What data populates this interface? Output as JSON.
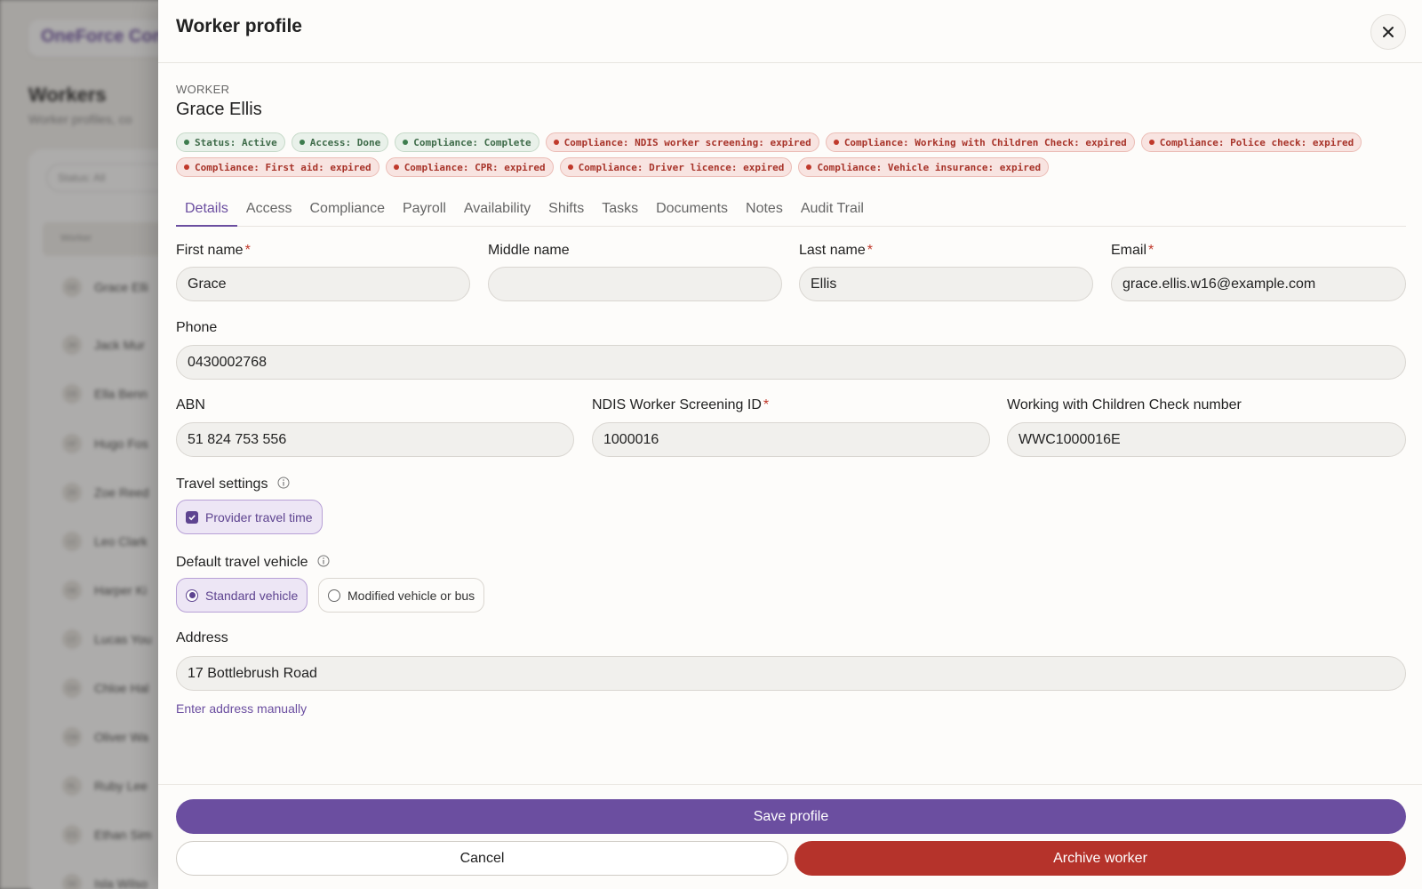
{
  "background": {
    "logo_text": "OneForce Con",
    "page_title": "Workers",
    "page_subtitle": "Worker profiles, co",
    "filter_label": "Status: All",
    "table_header": "Worker",
    "rows": [
      {
        "initials": "GE",
        "name": "Grace Elli"
      },
      {
        "initials": "JM",
        "name": "Jack Mur"
      },
      {
        "initials": "EB",
        "name": "Ella Benn"
      },
      {
        "initials": "HF",
        "name": "Hugo Fos"
      },
      {
        "initials": "ZR",
        "name": "Zoe Reed"
      },
      {
        "initials": "LC",
        "name": "Leo Clark"
      },
      {
        "initials": "HK",
        "name": "Harper Ki"
      },
      {
        "initials": "LY",
        "name": "Lucas You"
      },
      {
        "initials": "CH",
        "name": "Chloe Hal"
      },
      {
        "initials": "OW",
        "name": "Oliver Wa"
      },
      {
        "initials": "RL",
        "name": "Ruby Lee"
      },
      {
        "initials": "ES",
        "name": "Ethan Sim"
      },
      {
        "initials": "IW",
        "name": "Isla Wilso"
      }
    ]
  },
  "panel": {
    "title": "Worker profile",
    "eyebrow": "WORKER",
    "worker_name": "Grace Ellis",
    "badges": [
      {
        "text": "Status: Active",
        "tone": "ok"
      },
      {
        "text": "Access: Done",
        "tone": "ok"
      },
      {
        "text": "Compliance: Complete",
        "tone": "ok"
      },
      {
        "text": "Compliance: NDIS worker screening: expired",
        "tone": "bad"
      },
      {
        "text": "Compliance: Working with Children Check: expired",
        "tone": "bad"
      },
      {
        "text": "Compliance: Police check: expired",
        "tone": "bad"
      },
      {
        "text": "Compliance: First aid: expired",
        "tone": "bad"
      },
      {
        "text": "Compliance: CPR: expired",
        "tone": "bad"
      },
      {
        "text": "Compliance: Driver licence: expired",
        "tone": "bad"
      },
      {
        "text": "Compliance: Vehicle insurance: expired",
        "tone": "bad"
      }
    ],
    "tabs": [
      {
        "label": "Details",
        "active": true
      },
      {
        "label": "Access",
        "active": false
      },
      {
        "label": "Compliance",
        "active": false
      },
      {
        "label": "Payroll",
        "active": false
      },
      {
        "label": "Availability",
        "active": false
      },
      {
        "label": "Shifts",
        "active": false
      },
      {
        "label": "Tasks",
        "active": false
      },
      {
        "label": "Documents",
        "active": false
      },
      {
        "label": "Notes",
        "active": false
      },
      {
        "label": "Audit Trail",
        "active": false
      }
    ]
  },
  "form": {
    "first_name": {
      "label": "First name",
      "value": "Grace"
    },
    "middle_name": {
      "label": "Middle name",
      "value": ""
    },
    "last_name": {
      "label": "Last name",
      "value": "Ellis"
    },
    "email": {
      "label": "Email",
      "value": "grace.ellis.w16@example.com"
    },
    "phone": {
      "label": "Phone",
      "value": "0430002768"
    },
    "abn": {
      "label": "ABN",
      "value": "51 824 753 556"
    },
    "ndis_id": {
      "label": "NDIS Worker Screening ID",
      "value": "1000016"
    },
    "wwcc": {
      "label": "Working with Children Check number",
      "value": "WWC1000016E"
    },
    "required_marker": "*",
    "travel_settings": {
      "label": "Travel settings",
      "option": "Provider travel time",
      "checked": true
    },
    "travel_vehicle": {
      "label": "Default travel vehicle",
      "options": [
        {
          "label": "Standard vehicle",
          "selected": true
        },
        {
          "label": "Modified vehicle or bus",
          "selected": false
        }
      ]
    },
    "address": {
      "label": "Address",
      "value": "17 Bottlebrush Road"
    },
    "manual_address_link": "Enter address manually"
  },
  "footer": {
    "save_label": "Save profile",
    "cancel_label": "Cancel",
    "archive_label": "Archive worker"
  },
  "colors": {
    "accent": "#6b4ea0",
    "danger": "#b5332b",
    "ok": "#3e7d4f"
  }
}
